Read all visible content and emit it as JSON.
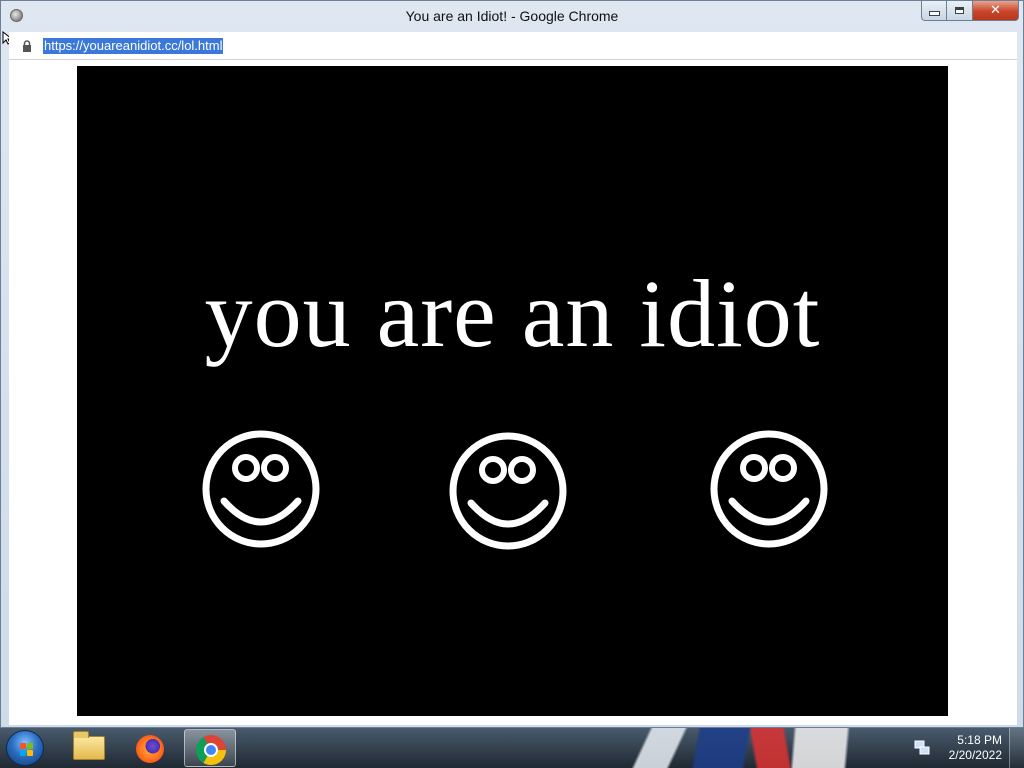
{
  "window": {
    "title": "You are an Idiot! - Google Chrome",
    "controls": {
      "minimize_icon": "minimize-icon",
      "maximize_icon": "maximize-icon",
      "close_icon": "close-icon",
      "close_glyph": "✕"
    }
  },
  "address_bar": {
    "url": "https://youareanidiot.cc/lol.html",
    "security_icon": "lock-icon",
    "url_selected": true
  },
  "page": {
    "background": "#000000",
    "headline": "you are an idiot",
    "smileys": [
      {
        "icon": "smiley-face-icon"
      },
      {
        "icon": "smiley-face-icon"
      },
      {
        "icon": "smiley-face-icon"
      }
    ]
  },
  "taskbar": {
    "start_button_icon": "windows-logo-icon",
    "pinned": [
      {
        "name": "Windows Explorer",
        "icon": "folder-icon",
        "active": false
      },
      {
        "name": "Firefox",
        "icon": "firefox-icon",
        "active": false
      },
      {
        "name": "Google Chrome",
        "icon": "chrome-icon",
        "active": true
      }
    ],
    "tray_icon": "network-icon",
    "clock": {
      "time": "5:18 PM",
      "date": "2/20/2022"
    }
  },
  "colors": {
    "url_highlight": "#3b78d8",
    "page_bg": "#000000",
    "text": "#ffffff",
    "close_button": "#c9452a"
  }
}
